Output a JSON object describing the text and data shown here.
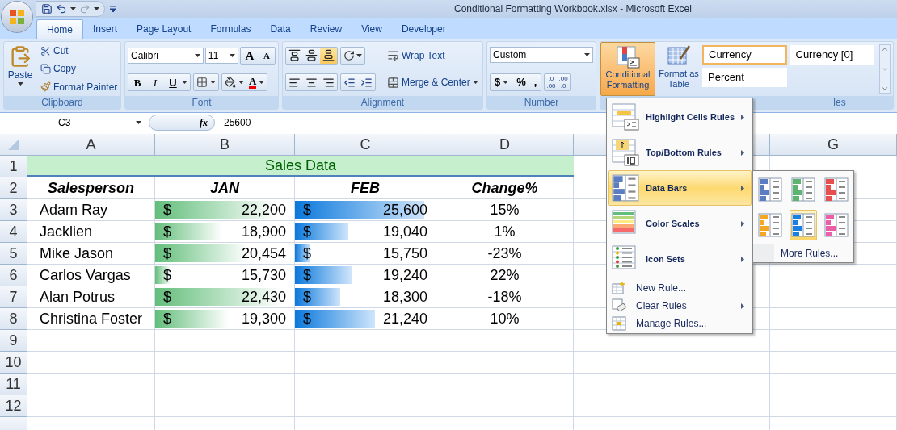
{
  "window": {
    "title": "Conditional Formatting Workbook.xlsx - Microsoft Excel"
  },
  "tabs": [
    {
      "label": "Home",
      "selected": true
    },
    {
      "label": "Insert",
      "selected": false
    },
    {
      "label": "Page Layout",
      "selected": false
    },
    {
      "label": "Formulas",
      "selected": false
    },
    {
      "label": "Data",
      "selected": false
    },
    {
      "label": "Review",
      "selected": false
    },
    {
      "label": "View",
      "selected": false
    },
    {
      "label": "Developer",
      "selected": false
    }
  ],
  "clipboard": {
    "label": "Clipboard",
    "paste": "Paste",
    "cut": "Cut",
    "copy": "Copy",
    "format_painter": "Format Painter"
  },
  "font": {
    "label": "Font",
    "font_name": "Calibri",
    "font_size": "11",
    "grow": "A",
    "shrink": "A",
    "bold": "B",
    "italic": "I",
    "underline": "U",
    "font_color": "A"
  },
  "alignment": {
    "label": "Alignment",
    "wrap_text": "Wrap Text",
    "merge_center": "Merge & Center"
  },
  "number": {
    "label": "Number",
    "format": "Custom",
    "currency": "$",
    "percent": "%",
    "comma": ",",
    "increase_decimal": [
      ".0",
      ".00"
    ],
    "decrease_decimal": [
      ".00",
      ".0"
    ]
  },
  "styles": {
    "label": "les",
    "conditional_formatting": {
      "label": "Conditional Formatting",
      "selected": true
    },
    "format_as_table": "Format as Table",
    "cell_styles": [
      {
        "label": "Currency",
        "selected": true
      },
      {
        "label": "Currency [0]",
        "selected": false
      },
      {
        "label": "Percent",
        "selected": false
      }
    ]
  },
  "formula_bar": {
    "name_box": "C3",
    "function_label": "fx",
    "formula": "25600"
  },
  "sheet": {
    "column_headers": [
      "A",
      "B",
      "C",
      "D"
    ],
    "right_column_headers": [
      "G"
    ],
    "title": "Sales Data",
    "header": [
      "Salesperson",
      "JAN",
      "FEB",
      "Change%"
    ],
    "rows": [
      {
        "salesperson": "Adam Ray",
        "jan": {
          "symbol": "$",
          "value": "22,200",
          "level": 0.88
        },
        "feb": {
          "symbol": "$",
          "value": "25,600",
          "level": 0.92
        },
        "change": "15%"
      },
      {
        "salesperson": "Jacklien",
        "jan": {
          "symbol": "$",
          "value": "18,900",
          "level": 0.48
        },
        "feb": {
          "symbol": "$",
          "value": "19,040",
          "level": 0.38
        },
        "change": "1%"
      },
      {
        "salesperson": "Mike Jason",
        "jan": {
          "symbol": "$",
          "value": "20,454",
          "level": 0.67
        },
        "feb": {
          "symbol": "$",
          "value": "15,750",
          "level": 0.11
        },
        "change": "-23%"
      },
      {
        "salesperson": "Carlos Vargas",
        "jan": {
          "symbol": "$",
          "value": "15,730",
          "level": 0.11
        },
        "feb": {
          "symbol": "$",
          "value": "19,240",
          "level": 0.4
        },
        "change": "22%"
      },
      {
        "salesperson": "Alan Potrus",
        "jan": {
          "symbol": "$",
          "value": "22,430",
          "level": 0.91
        },
        "feb": {
          "symbol": "$",
          "value": "18,300",
          "level": 0.32
        },
        "change": "-18%"
      },
      {
        "salesperson": "Christina Foster",
        "jan": {
          "symbol": "$",
          "value": "19,300",
          "level": 0.53
        },
        "feb": {
          "symbol": "$",
          "value": "21,240",
          "level": 0.57
        },
        "change": "10%"
      }
    ],
    "row_numbers": [
      "1",
      "2",
      "3",
      "4",
      "5",
      "6",
      "7",
      "8",
      "9",
      "10",
      "11",
      "12"
    ]
  },
  "menu": {
    "items": [
      {
        "kind": "large",
        "label": "Highlight Cells Rules",
        "submenu": true,
        "selected": false
      },
      {
        "kind": "large",
        "label": "Top/Bottom Rules",
        "submenu": true,
        "selected": false
      },
      {
        "kind": "large",
        "label": "Data Bars",
        "submenu": true,
        "selected": true
      },
      {
        "kind": "large",
        "label": "Color Scales",
        "submenu": true,
        "selected": false
      },
      {
        "kind": "large",
        "label": "Icon Sets",
        "submenu": true,
        "selected": false
      },
      {
        "kind": "small",
        "label": "New Rule...",
        "submenu": false,
        "selected": false
      },
      {
        "kind": "small",
        "label": "Clear Rules",
        "submenu": true,
        "selected": false
      },
      {
        "kind": "small",
        "label": "Manage Rules...",
        "submenu": false,
        "selected": false
      }
    ]
  },
  "submenu": {
    "swatches": [
      {
        "color": "#5b7dc1",
        "selected": false
      },
      {
        "color": "#5cb46e",
        "selected": false
      },
      {
        "color": "#e8504f",
        "selected": false
      },
      {
        "color": "#f5a623",
        "selected": false
      },
      {
        "color": "#1a7fe0",
        "selected": true
      },
      {
        "color": "#ec5fa8",
        "selected": false
      }
    ],
    "more": "More Rules..."
  }
}
